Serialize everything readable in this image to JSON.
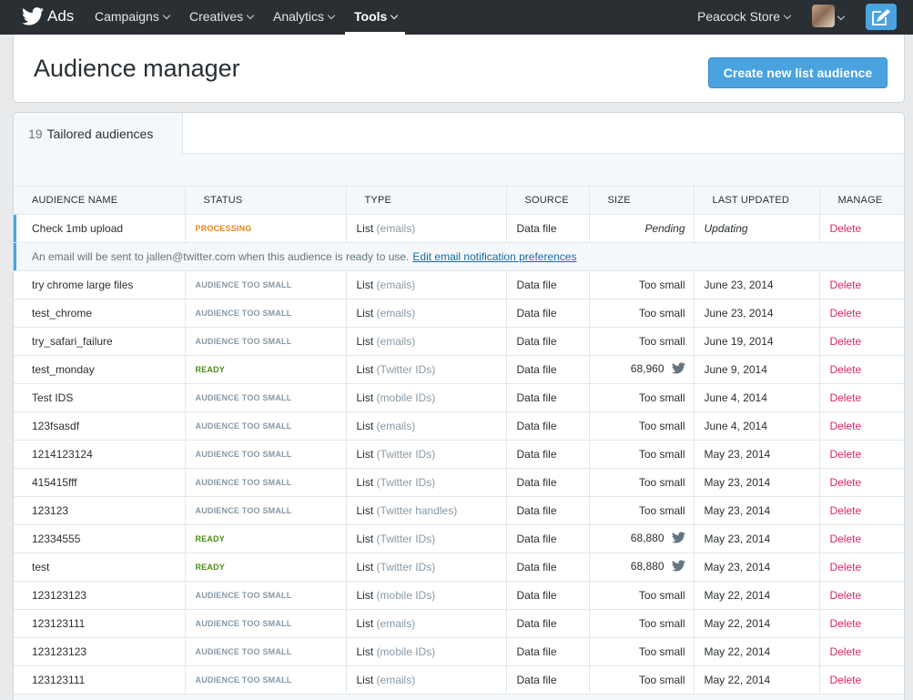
{
  "nav": {
    "brand": "Ads",
    "items": [
      {
        "label": "Campaigns"
      },
      {
        "label": "Creatives"
      },
      {
        "label": "Analytics"
      },
      {
        "label": "Tools"
      }
    ],
    "account": "Peacock Store"
  },
  "header": {
    "title": "Audience manager",
    "create_button": "Create new list audience"
  },
  "tab": {
    "count": "19",
    "label": "Tailored audiences"
  },
  "table": {
    "columns": [
      "AUDIENCE NAME",
      "STATUS",
      "TYPE",
      "SOURCE",
      "SIZE",
      "LAST UPDATED",
      "MANAGE"
    ],
    "notice": {
      "text": "An email will be sent to jallen@twitter.com when this audience is ready to use.",
      "link": "Edit email notification preferences"
    },
    "rows": [
      {
        "name": "Check 1mb upload",
        "status": "PROCESSING",
        "type": "List",
        "type_detail": "(emails)",
        "source": "Data file",
        "size": "Pending",
        "updated": "Updating",
        "manage": "Delete"
      },
      {
        "name": "try chrome large files",
        "status": "AUDIENCE TOO SMALL",
        "type": "List",
        "type_detail": "(emails)",
        "source": "Data file",
        "size": "Too small",
        "updated": "June 23, 2014",
        "manage": "Delete"
      },
      {
        "name": "test_chrome",
        "status": "AUDIENCE TOO SMALL",
        "type": "List",
        "type_detail": "(emails)",
        "source": "Data file",
        "size": "Too small",
        "updated": "June 23, 2014",
        "manage": "Delete"
      },
      {
        "name": "try_safari_failure",
        "status": "AUDIENCE TOO SMALL",
        "type": "List",
        "type_detail": "(emails)",
        "source": "Data file",
        "size": "Too small",
        "updated": "June 19, 2014",
        "manage": "Delete"
      },
      {
        "name": "test_monday",
        "status": "READY",
        "type": "List",
        "type_detail": "(Twitter IDs)",
        "source": "Data file",
        "size": "68,960",
        "updated": "June 9, 2014",
        "manage": "Delete"
      },
      {
        "name": "Test IDS",
        "status": "AUDIENCE TOO SMALL",
        "type": "List",
        "type_detail": "(mobile IDs)",
        "source": "Data file",
        "size": "Too small",
        "updated": "June 4, 2014",
        "manage": "Delete"
      },
      {
        "name": "123fsasdf",
        "status": "AUDIENCE TOO SMALL",
        "type": "List",
        "type_detail": "(emails)",
        "source": "Data file",
        "size": "Too small",
        "updated": "June 4, 2014",
        "manage": "Delete"
      },
      {
        "name": "1214123124",
        "status": "AUDIENCE TOO SMALL",
        "type": "List",
        "type_detail": "(Twitter IDs)",
        "source": "Data file",
        "size": "Too small",
        "updated": "May 23, 2014",
        "manage": "Delete"
      },
      {
        "name": "415415fff",
        "status": "AUDIENCE TOO SMALL",
        "type": "List",
        "type_detail": "(Twitter IDs)",
        "source": "Data file",
        "size": "Too small",
        "updated": "May 23, 2014",
        "manage": "Delete"
      },
      {
        "name": "123123",
        "status": "AUDIENCE TOO SMALL",
        "type": "List",
        "type_detail": "(Twitter handles)",
        "source": "Data file",
        "size": "Too small",
        "updated": "May 23, 2014",
        "manage": "Delete"
      },
      {
        "name": "12334555",
        "status": "READY",
        "type": "List",
        "type_detail": "(Twitter IDs)",
        "source": "Data file",
        "size": "68,880",
        "updated": "May 23, 2014",
        "manage": "Delete"
      },
      {
        "name": "test",
        "status": "READY",
        "type": "List",
        "type_detail": "(Twitter IDs)",
        "source": "Data file",
        "size": "68,880",
        "updated": "May 23, 2014",
        "manage": "Delete"
      },
      {
        "name": "123123123",
        "status": "AUDIENCE TOO SMALL",
        "type": "List",
        "type_detail": "(mobile IDs)",
        "source": "Data file",
        "size": "Too small",
        "updated": "May 22, 2014",
        "manage": "Delete"
      },
      {
        "name": "123123111",
        "status": "AUDIENCE TOO SMALL",
        "type": "List",
        "type_detail": "(emails)",
        "source": "Data file",
        "size": "Too small",
        "updated": "May 22, 2014",
        "manage": "Delete"
      },
      {
        "name": "123123123",
        "status": "AUDIENCE TOO SMALL",
        "type": "List",
        "type_detail": "(mobile IDs)",
        "source": "Data file",
        "size": "Too small",
        "updated": "May 22, 2014",
        "manage": "Delete"
      },
      {
        "name": "123123111",
        "status": "AUDIENCE TOO SMALL",
        "type": "List",
        "type_detail": "(emails)",
        "source": "Data file",
        "size": "Too small",
        "updated": "May 22, 2014",
        "manage": "Delete"
      }
    ]
  },
  "colors": {
    "nav_bg": "#292f33",
    "accent": "#4aa3df",
    "processing": "#e8851c",
    "too_small": "#8899a6",
    "ready": "#4d8b16",
    "delete": "#e0245e"
  },
  "icons": [
    "twitter-bird-icon",
    "chevron-down-icon",
    "compose-icon",
    "avatar"
  ]
}
